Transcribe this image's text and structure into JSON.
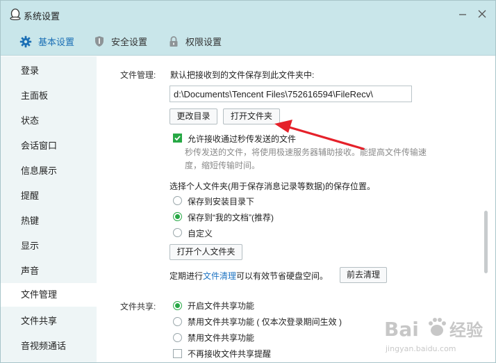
{
  "window": {
    "title": "系统设置"
  },
  "tabs": [
    {
      "label": "基本设置",
      "icon": "gear-icon",
      "active": true
    },
    {
      "label": "安全设置",
      "icon": "shield-icon"
    },
    {
      "label": "权限设置",
      "icon": "lock-icon"
    }
  ],
  "sidebar": {
    "items": [
      {
        "label": "登录"
      },
      {
        "label": "主面板"
      },
      {
        "label": "状态"
      },
      {
        "label": "会话窗口"
      },
      {
        "label": "信息展示"
      },
      {
        "label": "提醒"
      },
      {
        "label": "热键"
      },
      {
        "label": "显示"
      },
      {
        "label": "声音"
      },
      {
        "label": "文件管理",
        "active": true
      },
      {
        "label": "文件共享"
      },
      {
        "label": "音视频通话"
      }
    ]
  },
  "file_mgmt": {
    "section_label": "文件管理:",
    "description": "默认把接收到的文件保存到此文件夹中:",
    "path_value": "d:\\Documents\\Tencent Files\\752616594\\FileRecv\\",
    "change_dir_button": "更改目录",
    "open_folder_button": "打开文件夹",
    "allow_fast_label": "允许接收通过秒传发送的文件",
    "allow_fast_checked": true,
    "fast_hint": "秒传发送的文件，将使用极速服务器辅助接收。能提高文件传输速度，缩短传输时间。",
    "personal_folder_desc": "选择个人文件夹(用于保存消息记录等数据)的保存位置。",
    "radio_install": "保存到安装目录下",
    "radio_mydocs": "保存到“我的文档”(推荐)",
    "radio_custom": "自定义",
    "selected_location": "保存到“我的文档”(推荐)",
    "open_personal_button": "打开个人文件夹",
    "cleanup_prefix": "定期进行",
    "cleanup_link": "文件清理",
    "cleanup_suffix": "可以有效节省硬盘空间。",
    "goto_cleanup_button": "前去清理"
  },
  "file_share": {
    "section_label": "文件共享:",
    "radio_enable": "开启文件共享功能",
    "radio_disable_session": "禁用文件共享功能 ( 仅本次登录期间生效 )",
    "radio_disable": "禁用文件共享功能",
    "selected": "开启文件共享功能",
    "no_reminder_label": "不再接收文件共享提醒",
    "no_reminder_checked": false
  },
  "watermark": {
    "brand": "Bai",
    "brand2": "经验",
    "url": "jingyan.baidu.com"
  },
  "colors": {
    "accent": "#1b6fb5",
    "check_green": "#27a845",
    "link": "#1d73c2",
    "arrow": "#e5212a"
  }
}
